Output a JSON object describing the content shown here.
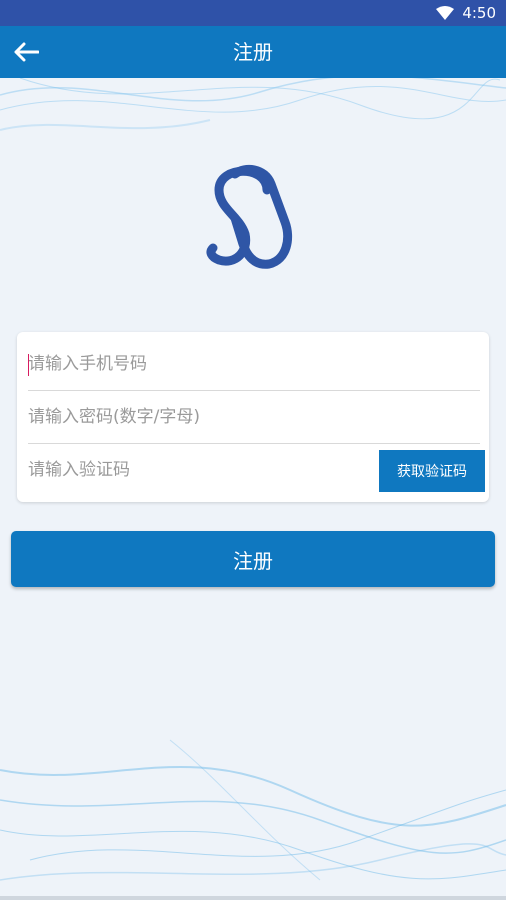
{
  "status_bar": {
    "time": "4:50",
    "icons": [
      "wifi-icon",
      "battery-icon"
    ]
  },
  "app_bar": {
    "title": "注册",
    "back_icon": "arrow-left-icon"
  },
  "form": {
    "phone_placeholder": "请输入手机号码",
    "phone_value": "",
    "password_placeholder": "请输入密码(数字/字母)",
    "password_value": "",
    "code_placeholder": "请输入验证码",
    "code_value": "",
    "get_code_label": "获取验证码"
  },
  "register_button": {
    "label": "注册"
  },
  "colors": {
    "status_bar": "#2f52a8",
    "accent": "#0f78c0",
    "background": "#eef3f9",
    "logo": "#2f56a6"
  }
}
